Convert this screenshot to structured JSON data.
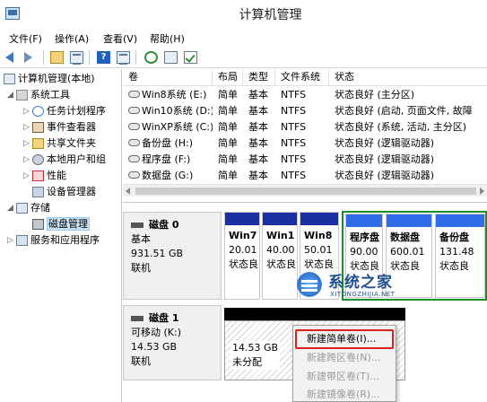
{
  "window": {
    "title": "计算机管理"
  },
  "menubar": {
    "items": [
      "文件(F)",
      "操作(A)",
      "查看(V)",
      "帮助(H)"
    ]
  },
  "toolbar": {
    "buttons": [
      "back-icon",
      "forward-icon",
      "up-folder-icon",
      "show-hide-tree-icon",
      "help-icon",
      "console-icon",
      "refresh-icon",
      "properties-icon",
      "check-icon"
    ]
  },
  "tree": {
    "root": "计算机管理(本地)",
    "system_tools": "系统工具",
    "task_scheduler": "任务计划程序",
    "event_viewer": "事件查看器",
    "shared_folders": "共享文件夹",
    "local_users": "本地用户和组",
    "performance": "性能",
    "device_manager": "设备管理器",
    "storage": "存储",
    "disk_management": "磁盘管理",
    "services": "服务和应用程序"
  },
  "volume_list": {
    "columns": [
      "卷",
      "布局",
      "类型",
      "文件系统",
      "状态"
    ],
    "rows": [
      [
        "Win8系统 (E:)",
        "简单",
        "基本",
        "NTFS",
        "状态良好 (主分区)"
      ],
      [
        "Win10系统 (D:)",
        "简单",
        "基本",
        "NTFS",
        "状态良好 (启动, 页面文件, 故障"
      ],
      [
        "WinXP系统 (C:)",
        "简单",
        "基本",
        "NTFS",
        "状态良好 (系统, 活动, 主分区)"
      ],
      [
        "备份盘 (H:)",
        "简单",
        "基本",
        "NTFS",
        "状态良好 (逻辑驱动器)"
      ],
      [
        "程序盘 (F:)",
        "简单",
        "基本",
        "NTFS",
        "状态良好 (逻辑驱动器)"
      ],
      [
        "数据盘 (G:)",
        "简单",
        "基本",
        "NTFS",
        "状态良好 (逻辑驱动器)"
      ]
    ]
  },
  "disk0": {
    "name": "磁盘 0",
    "type": "基本",
    "size": "931.51 GB",
    "status": "联机",
    "partitions": [
      {
        "name": "Win7",
        "size": "20.01",
        "state": "状态良"
      },
      {
        "name": "Win1",
        "size": "40.00",
        "state": "状态良"
      },
      {
        "name": "Win8",
        "size": "50.01",
        "state": "状态良"
      },
      {
        "name": "程序盘",
        "size": "90.00",
        "state": "状态良"
      },
      {
        "name": "数据盘",
        "size": "600.01",
        "state": "状态良"
      },
      {
        "name": "备份盘",
        "size": "131.48",
        "state": "状态良"
      }
    ]
  },
  "disk1": {
    "name": "磁盘 1",
    "type": "可移动 (K:)",
    "size": "14.53 GB",
    "status": "联机",
    "unallocated": {
      "size": "14.53 GB",
      "label": "未分配"
    }
  },
  "watermark": {
    "cn": "系统之家",
    "en": "XITONGZHIJIA.NET"
  },
  "context_menu": {
    "items": [
      "新建简单卷(I)...",
      "新建跨区卷(N)...",
      "新建带区卷(T)...",
      "新建镜像卷(R)..."
    ]
  },
  "colors": {
    "primary_stripe": "#1a2fa0",
    "logical_stripe": "#2f6ee8",
    "selection_frame": "#1a8f2a",
    "highlight_box": "#d92020"
  }
}
